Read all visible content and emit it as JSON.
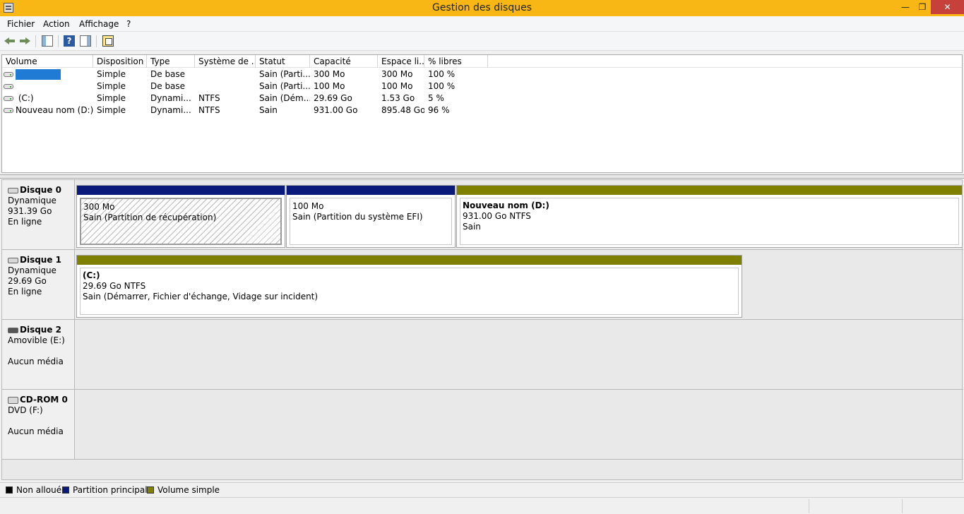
{
  "window": {
    "title": "Gestion des disques",
    "min_glyph": "—",
    "max_glyph": "❐",
    "close_glyph": "✕"
  },
  "menu": [
    "Fichier",
    "Action",
    "Affichage",
    "?"
  ],
  "toolbar": {
    "help_glyph": "?"
  },
  "volumes": {
    "columns": [
      "Volume",
      "Disposition",
      "Type",
      "Système de ...",
      "Statut",
      "Capacité",
      "Espace li...",
      "% libres"
    ],
    "rows": [
      {
        "volume": "",
        "disposition": "Simple",
        "type": "De base",
        "fs": "",
        "statut": "Sain (Parti...",
        "capacite": "300 Mo",
        "espace": "300 Mo",
        "libres": "100 %"
      },
      {
        "volume": "",
        "disposition": "Simple",
        "type": "De base",
        "fs": "",
        "statut": "Sain (Parti...",
        "capacite": "100 Mo",
        "espace": "100 Mo",
        "libres": "100 %"
      },
      {
        "volume": " (C:)",
        "disposition": "Simple",
        "type": "Dynami...",
        "fs": "NTFS",
        "statut": "Sain (Dém...",
        "capacite": "29.69 Go",
        "espace": "1.53 Go",
        "libres": "5 %"
      },
      {
        "volume": "Nouveau nom (D:)",
        "disposition": "Simple",
        "type": "Dynami...",
        "fs": "NTFS",
        "statut": "Sain",
        "capacite": "931.00 Go",
        "espace": "895.48 Go",
        "libres": "96 %"
      }
    ]
  },
  "disks": [
    {
      "name": "Disque 0",
      "line1": "Dynamique",
      "line2": "931.39 Go",
      "line3": "En ligne",
      "partitions": [
        {
          "title": "",
          "size": "300 Mo",
          "status": "Sain (Partition de récupération)"
        },
        {
          "title": "",
          "size": "100 Mo",
          "status": "Sain (Partition du système EFI)"
        },
        {
          "title": "Nouveau nom  (D:)",
          "size": "931.00 Go NTFS",
          "status": "Sain"
        }
      ]
    },
    {
      "name": "Disque 1",
      "line1": "Dynamique",
      "line2": "29.69 Go",
      "line3": "En ligne",
      "partitions": [
        {
          "title": " (C:)",
          "size": "29.69 Go NTFS",
          "status": "Sain (Démarrer, Fichier d'échange, Vidage sur incident)"
        }
      ]
    },
    {
      "name": "Disque 2",
      "line1": "Amovible (E:)",
      "line2": "",
      "line3": "Aucun média",
      "partitions": []
    },
    {
      "name": "CD-ROM 0",
      "line1": "DVD (F:)",
      "line2": "",
      "line3": "Aucun média",
      "partitions": []
    }
  ],
  "legend": [
    {
      "label": "Non alloué",
      "color": "#000000"
    },
    {
      "label": "Partition principale",
      "color": "#0a1a7a"
    },
    {
      "label": "Volume simple",
      "color": "#808000"
    }
  ],
  "colors": {
    "title_bar": "#f9b716",
    "primary_partition": "#0a1a7a",
    "simple_volume": "#808000",
    "selection": "#1f7bd4"
  }
}
